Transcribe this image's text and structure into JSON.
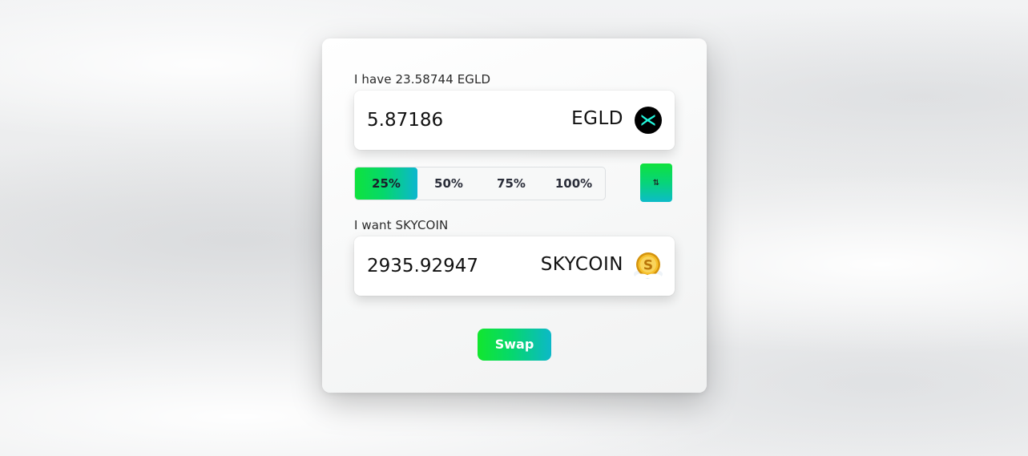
{
  "from": {
    "balance_label": "I have 23.58744 EGLD",
    "amount": "5.87186",
    "symbol": "EGLD",
    "icon": "egld-icon"
  },
  "percent_options": [
    {
      "label": "25%",
      "selected": true
    },
    {
      "label": "50%",
      "selected": false
    },
    {
      "label": "75%",
      "selected": false
    },
    {
      "label": "100%",
      "selected": false
    }
  ],
  "switch_button": {
    "icon": "swap-arrows-icon",
    "glyph": "⇅"
  },
  "to": {
    "want_label": "I want SKYCOIN",
    "amount": "2935.92947",
    "symbol": "SKYCOIN",
    "icon": "skycoin-icon"
  },
  "swap_button": {
    "label": "Swap"
  },
  "colors": {
    "accent_green": "#0fe23d",
    "accent_cyan": "#0cb6cf",
    "egld_icon_bg": "#000000",
    "egld_icon_fg": "#23f7dd",
    "skycoin_gold": "#f2b51c"
  }
}
